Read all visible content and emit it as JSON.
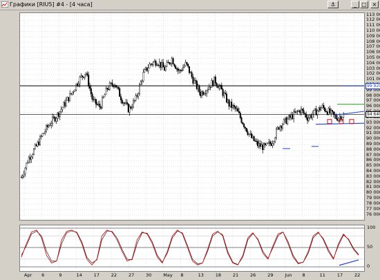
{
  "window": {
    "title": "Графики [RIU5] #4 - [4 часа]",
    "buttons": {
      "pin": "⚓",
      "minimize": "_",
      "maximize": "□",
      "close": "×"
    }
  },
  "colors": {
    "background": "#ffffff",
    "candles": "#000000",
    "grid": "#c8c8c8",
    "level_line": "#000000",
    "trend_line": "#1f3fcf",
    "resistance_line": "#1a9a1a",
    "box_markers": "#d01010",
    "oscillator_fast": "#d01010",
    "oscillator_slow": "#000000"
  },
  "price_axis": {
    "labels": [
      "113 000",
      "112 000",
      "111 000",
      "110 000",
      "109 000",
      "108 000",
      "107 000",
      "106 000",
      "105 000",
      "104 000",
      "103 000",
      "102 000",
      "101 000",
      "100 000",
      "99 000",
      "98 000",
      "97 000",
      "96 000",
      "95 000",
      "94 000",
      "93 000",
      "92 000",
      "91 000",
      "90 000",
      "89 000",
      "88 000",
      "87 000",
      "86 000",
      "85 000",
      "84 000",
      "83 000",
      "82 000",
      "81 000",
      "80 000",
      "79 000",
      "78 000",
      "77 000",
      "76 000"
    ],
    "tag_blue": "99 920",
    "tag_black": "94 640"
  },
  "osc_axis": {
    "labels": [
      "100",
      "50",
      "0"
    ]
  },
  "time_axis": {
    "labels": [
      "Apr",
      "6",
      "9",
      "14",
      "17",
      "22",
      "27",
      "30",
      "May",
      "8",
      "13",
      "18",
      "21",
      "26",
      "29",
      "Jun",
      "8",
      "11",
      "17",
      "22"
    ]
  },
  "chart_data": {
    "type": "candlestick",
    "x": [
      "Apr",
      "6",
      "9",
      "14",
      "17",
      "22",
      "27",
      "30",
      "May",
      "8",
      "13",
      "18",
      "21",
      "26",
      "29",
      "Jun",
      "8",
      "11",
      "17",
      "22"
    ],
    "ylim": [
      76000,
      113000
    ],
    "close_path": [
      83000,
      86500,
      88500,
      91000,
      93000,
      94500,
      96500,
      98500,
      101000,
      102500,
      97000,
      96000,
      99500,
      100500,
      97500,
      95500,
      97500,
      102000,
      104000,
      104500,
      103000,
      105000,
      102500,
      104000,
      101000,
      98500,
      99500,
      101000,
      99000,
      96500,
      95500,
      93000,
      90500,
      89000,
      88500,
      89500,
      92500,
      93500,
      94500,
      95500,
      94000,
      95000,
      96000,
      95000,
      94000,
      94500
    ],
    "levels": [
      {
        "label": "99 920",
        "value": 99920
      },
      {
        "label": "94 640",
        "value": 94640
      }
    ],
    "oscillator": {
      "ylim": [
        0,
        100
      ],
      "ticks": [
        100,
        50,
        0
      ],
      "fast": [
        25,
        60,
        90,
        95,
        75,
        30,
        10,
        15,
        70,
        92,
        95,
        88,
        60,
        20,
        5,
        20,
        80,
        95,
        90,
        70,
        40,
        15,
        20,
        70,
        90,
        85,
        60,
        25,
        10,
        40,
        80,
        95,
        85,
        50,
        15,
        5,
        10,
        45,
        85,
        92,
        80,
        35,
        10,
        5,
        30,
        75,
        88,
        70,
        35,
        20,
        55,
        85,
        90,
        60,
        25,
        8,
        12,
        40,
        80,
        90,
        70,
        40,
        20,
        60,
        85,
        70,
        45,
        30
      ],
      "slow": [
        30,
        55,
        85,
        92,
        80,
        40,
        15,
        15,
        60,
        88,
        93,
        90,
        65,
        25,
        10,
        18,
        70,
        92,
        92,
        75,
        45,
        20,
        18,
        60,
        88,
        87,
        65,
        30,
        12,
        35,
        75,
        92,
        88,
        55,
        20,
        8,
        10,
        40,
        80,
        90,
        83,
        40,
        12,
        6,
        25,
        70,
        86,
        72,
        40,
        22,
        50,
        80,
        90,
        65,
        30,
        10,
        12,
        35,
        75,
        88,
        73,
        45,
        22,
        55,
        82,
        72,
        48,
        32
      ]
    }
  }
}
